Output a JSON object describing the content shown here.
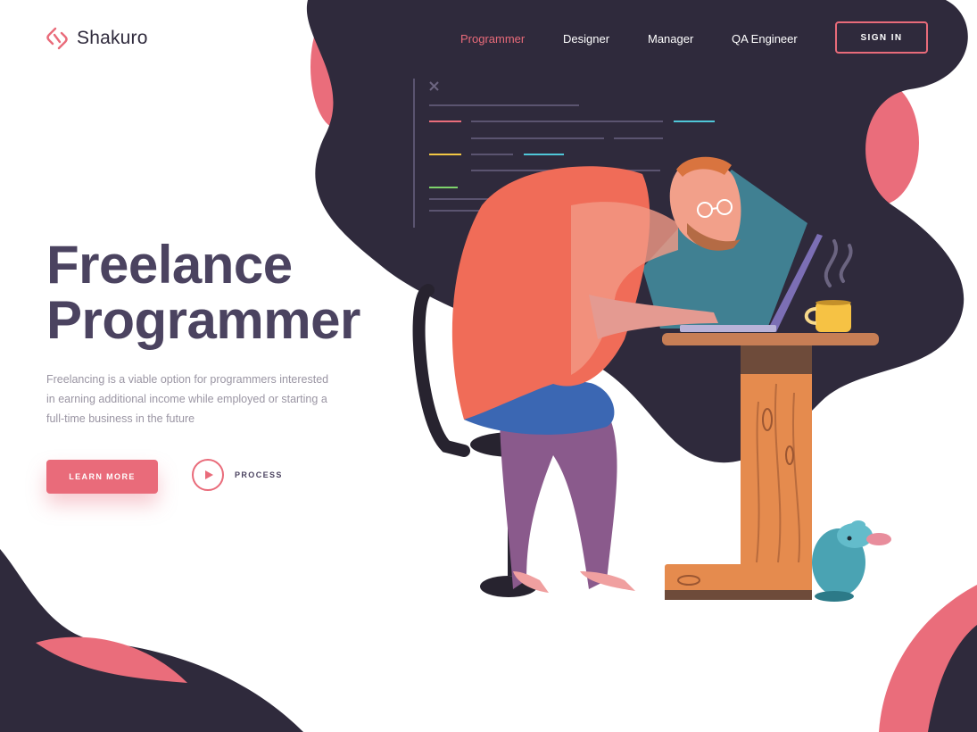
{
  "brand": {
    "name": "Shakuro",
    "icon": "shakuro-logo-icon"
  },
  "nav": {
    "items": [
      {
        "label": "Programmer",
        "active": true
      },
      {
        "label": "Designer",
        "active": false
      },
      {
        "label": "Manager",
        "active": false
      },
      {
        "label": "QA Engineer",
        "active": false
      }
    ],
    "signin_label": "SIGN IN"
  },
  "hero": {
    "title_line1": "Freelance",
    "title_line2": "Programmer",
    "description": "Freelancing is a viable option for programmers interested in earning additional income while employed or starting a full-time business in the future",
    "learn_more_label": "LEARN MORE",
    "process_label": "PROCESS",
    "process_icon": "play-icon"
  },
  "illustration": {
    "subject": "programmer-at-laptop-illustration",
    "code_panel_close_icon": "close-icon"
  },
  "colors": {
    "accent": "#e96b7a",
    "dark": "#2f2a3c",
    "title": "#4b4360",
    "muted": "#9a95a3"
  }
}
